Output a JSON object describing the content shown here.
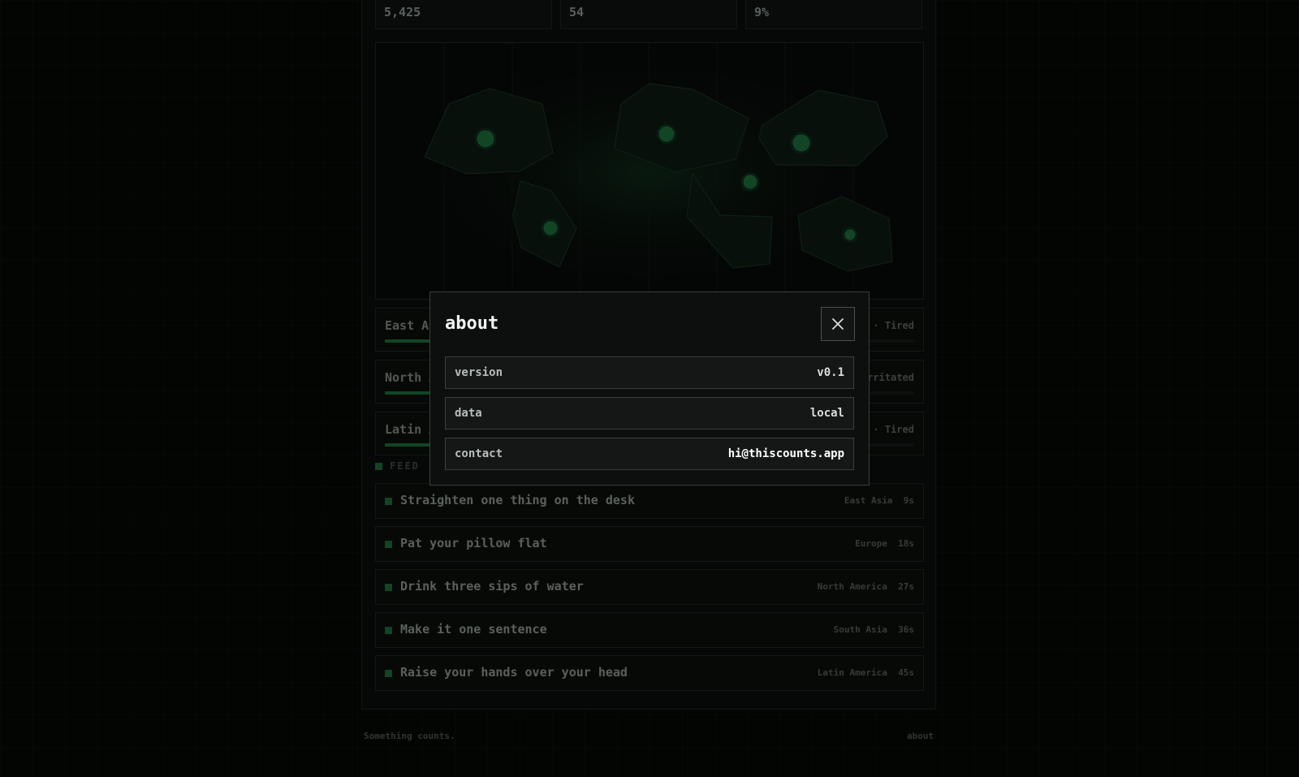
{
  "stats": [
    "5,425",
    "54",
    "9%"
  ],
  "regions": [
    {
      "name": "East Asia",
      "mood": "· Tired",
      "fill": 0.09
    },
    {
      "name": "North America",
      "mood": "Irritated",
      "fill": 0.09
    },
    {
      "name": "Latin America",
      "mood": "· Tired",
      "fill": 0.09
    }
  ],
  "feed": {
    "label": "FEED",
    "items": [
      {
        "text": "Straighten one thing on the desk",
        "region": "East Asia",
        "age": "9s"
      },
      {
        "text": "Pat your pillow flat",
        "region": "Europe",
        "age": "18s"
      },
      {
        "text": "Drink three sips of water",
        "region": "North America",
        "age": "27s"
      },
      {
        "text": "Make it one sentence",
        "region": "South Asia",
        "age": "36s"
      },
      {
        "text": "Raise your hands over your head",
        "region": "Latin America",
        "age": "45s"
      }
    ]
  },
  "footer": {
    "tagline": "Something counts.",
    "about_link": "about"
  },
  "modal": {
    "title": "about",
    "close_icon": "close-icon",
    "rows": [
      {
        "key": "version",
        "value": "v0.1"
      },
      {
        "key": "data",
        "value": "local"
      },
      {
        "key": "contact",
        "value": "hi@thiscounts.app"
      }
    ]
  },
  "colors": {
    "accent": "#1b6a38",
    "background": "#050806",
    "modal_bg": "#0d0f0e"
  }
}
